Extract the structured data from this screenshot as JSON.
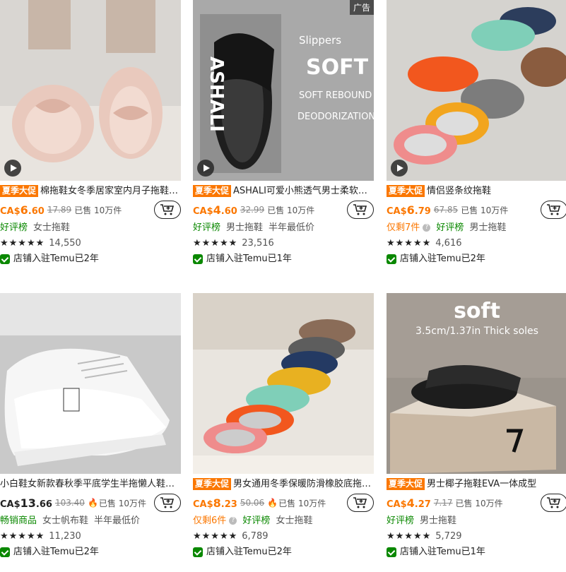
{
  "products": [
    {
      "promo": "夏季大促",
      "title": "棉拖鞋女冬季居家室内月子拖鞋…",
      "currency": "CA$",
      "price_int": "6",
      "price_dec": ".60",
      "orig_price": "17.89",
      "sold": "已售 10万件",
      "tags": [
        {
          "text": "好评榜",
          "style": "green"
        },
        {
          "text": "女士拖鞋",
          "style": "gray"
        }
      ],
      "rating_count": "14,550",
      "store": "店铺入驻Temu已2年",
      "has_video": true,
      "is_ad": false
    },
    {
      "promo": "夏季大促",
      "title": "ASHALI可爱小熊透气男士柔软…",
      "currency": "CA$",
      "price_int": "4",
      "price_dec": ".60",
      "orig_price": "32.99",
      "sold": "已售 10万件",
      "tags": [
        {
          "text": "好评榜",
          "style": "green"
        },
        {
          "text": "男士拖鞋",
          "style": "gray"
        },
        {
          "text": "半年最低价",
          "style": "gray"
        }
      ],
      "rating_count": "23,516",
      "store": "店铺入驻Temu已1年",
      "has_video": true,
      "is_ad": true,
      "ad_label": "广告",
      "image_text": {
        "brand": "ASHALI",
        "l1": "Slippers",
        "l2": "SOFT",
        "l3": "SOFT REBOUND",
        "l4": "DEODORIZATION"
      }
    },
    {
      "promo": "夏季大促",
      "title": "情侣竖条纹拖鞋",
      "currency": "CA$",
      "price_int": "6",
      "price_dec": ".79",
      "orig_price": "67.85",
      "sold": "已售 10万件",
      "tags": [
        {
          "text": "仅剩7件",
          "style": "orange",
          "help": true
        },
        {
          "text": "好评榜",
          "style": "green"
        },
        {
          "text": "男士拖鞋",
          "style": "gray"
        }
      ],
      "rating_count": "4,616",
      "store": "店铺入驻Temu已2年",
      "has_video": true,
      "is_ad": false
    },
    {
      "promo": "",
      "title": "小白鞋女新款春秋季平底学生半拖懒人鞋…",
      "currency": "CA$",
      "price_int": "13",
      "price_dec": ".66",
      "orig_price": "103.40",
      "sold": "已售 10万件",
      "hot": true,
      "price_color": "dark",
      "tags": [
        {
          "text": "畅销商品",
          "style": "green"
        },
        {
          "text": "女士帆布鞋",
          "style": "gray"
        },
        {
          "text": "半年最低价",
          "style": "gray"
        }
      ],
      "rating_count": "11,230",
      "store": "店铺入驻Temu已2年",
      "has_video": false,
      "is_ad": false
    },
    {
      "promo": "夏季大促",
      "title": "男女通用冬季保暖防滑橡胶底拖…",
      "currency": "CA$",
      "price_int": "8",
      "price_dec": ".23",
      "orig_price": "50.06",
      "sold": "已售 10万件",
      "hot": true,
      "tags": [
        {
          "text": "仅剩6件",
          "style": "orange",
          "help": true
        },
        {
          "text": "好评榜",
          "style": "green"
        },
        {
          "text": "女士拖鞋",
          "style": "gray"
        }
      ],
      "rating_count": "6,789",
      "store": "店铺入驻Temu已2年",
      "has_video": false,
      "is_ad": false
    },
    {
      "promo": "夏季大促",
      "title": "男士椰子拖鞋EVA一体成型",
      "currency": "CA$",
      "price_int": "4",
      "price_dec": ".27",
      "orig_price": "7.17",
      "sold": "已售 10万件",
      "tags": [
        {
          "text": "好评榜",
          "style": "green"
        },
        {
          "text": "男士拖鞋",
          "style": "gray"
        }
      ],
      "rating_count": "5,729",
      "store": "店铺入驻Temu已1年",
      "has_video": false,
      "is_ad": false,
      "image_text": {
        "l1": "soft",
        "l2": "3.5cm/1.37in Thick soles"
      }
    }
  ],
  "stars_text": "★★★★★",
  "colors": {
    "accent": "#fb7701",
    "green": "#0a8800"
  }
}
